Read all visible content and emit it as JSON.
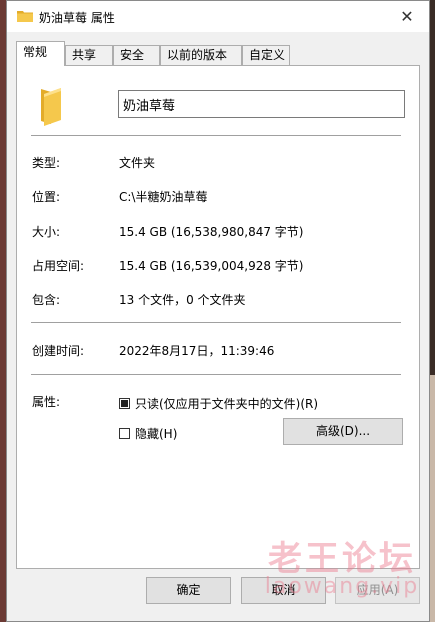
{
  "window": {
    "title": "奶油草莓 属性",
    "close_glyph": "✕"
  },
  "tabs": [
    {
      "label": "常规",
      "active": true
    },
    {
      "label": "共享"
    },
    {
      "label": "安全"
    },
    {
      "label": "以前的版本"
    },
    {
      "label": "自定义"
    }
  ],
  "general": {
    "name_value": "奶油草莓",
    "rows": {
      "type": {
        "label": "类型:",
        "value": "文件夹"
      },
      "location": {
        "label": "位置:",
        "value": "C:\\半糖奶油草莓"
      },
      "size": {
        "label": "大小:",
        "value": "15.4 GB (16,538,980,847 字节)"
      },
      "size_on_disk": {
        "label": "占用空间:",
        "value": "15.4 GB (16,539,004,928 字节)"
      },
      "contains": {
        "label": "包含:",
        "value": "13 个文件，0 个文件夹"
      },
      "created": {
        "label": "创建时间:",
        "value": "2022年8月17日，11:39:46"
      },
      "attributes": {
        "label": "属性:"
      }
    },
    "readonly_label": "只读(仅应用于文件夹中的文件)(R)",
    "readonly_state": "indeterminate",
    "hidden_label": "隐藏(H)",
    "hidden_checked": false,
    "advanced_label": "高级(D)..."
  },
  "buttons": {
    "ok": "确定",
    "cancel": "取消",
    "apply": "应用(A)"
  },
  "watermark": {
    "cn": "老王论坛",
    "en": "laowang.vip"
  },
  "colors": {
    "folder": "#f5c84c",
    "folder_dark": "#e3ac2a",
    "watermark": "#eb788c"
  },
  "icons": [
    "folder-icon",
    "close-icon",
    "checkbox-indeterminate-icon",
    "checkbox-empty-icon"
  ]
}
